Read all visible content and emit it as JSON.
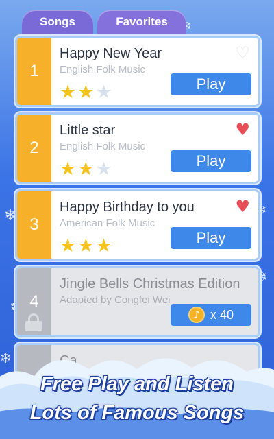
{
  "tabs": [
    {
      "label": "Songs"
    },
    {
      "label": "Favorites"
    }
  ],
  "songs": [
    {
      "number": "1",
      "title": "Happy New Year",
      "subtitle": "English Folk Music",
      "stars_filled": 2,
      "stars_total": 3,
      "favorite": false,
      "action_label": "Play",
      "locked": false
    },
    {
      "number": "2",
      "title": "Little star",
      "subtitle": "English Folk Music",
      "stars_filled": 2,
      "stars_total": 3,
      "favorite": true,
      "action_label": "Play",
      "locked": false
    },
    {
      "number": "3",
      "title": "Happy Birthday to you",
      "subtitle": "American Folk Music",
      "stars_filled": 3,
      "stars_total": 3,
      "favorite": true,
      "action_label": "Play",
      "locked": false
    },
    {
      "number": "4",
      "title": "Jingle Bells Christmas Edition",
      "subtitle": "Adapted by Congfei Wei",
      "locked": true,
      "cost_label": "x 40",
      "icon": "lock-icon"
    },
    {
      "number": "",
      "title": "Ca",
      "subtitle": "",
      "locked": true
    }
  ],
  "icons": {
    "star": "star-icon",
    "heart": "heart-icon",
    "coin": "music-coin-icon",
    "lock": "lock-icon",
    "snowflake": "snowflake-icon"
  },
  "colors": {
    "number_unlocked": "#f6b02a",
    "number_locked": "#b6b9bf",
    "play_button": "#3d88e8",
    "heart_favorite": "#e64d56",
    "tab": "#7a6ad8"
  },
  "banner": {
    "line1": "Free Play and Listen",
    "line2": "Lots of Famous Songs"
  }
}
